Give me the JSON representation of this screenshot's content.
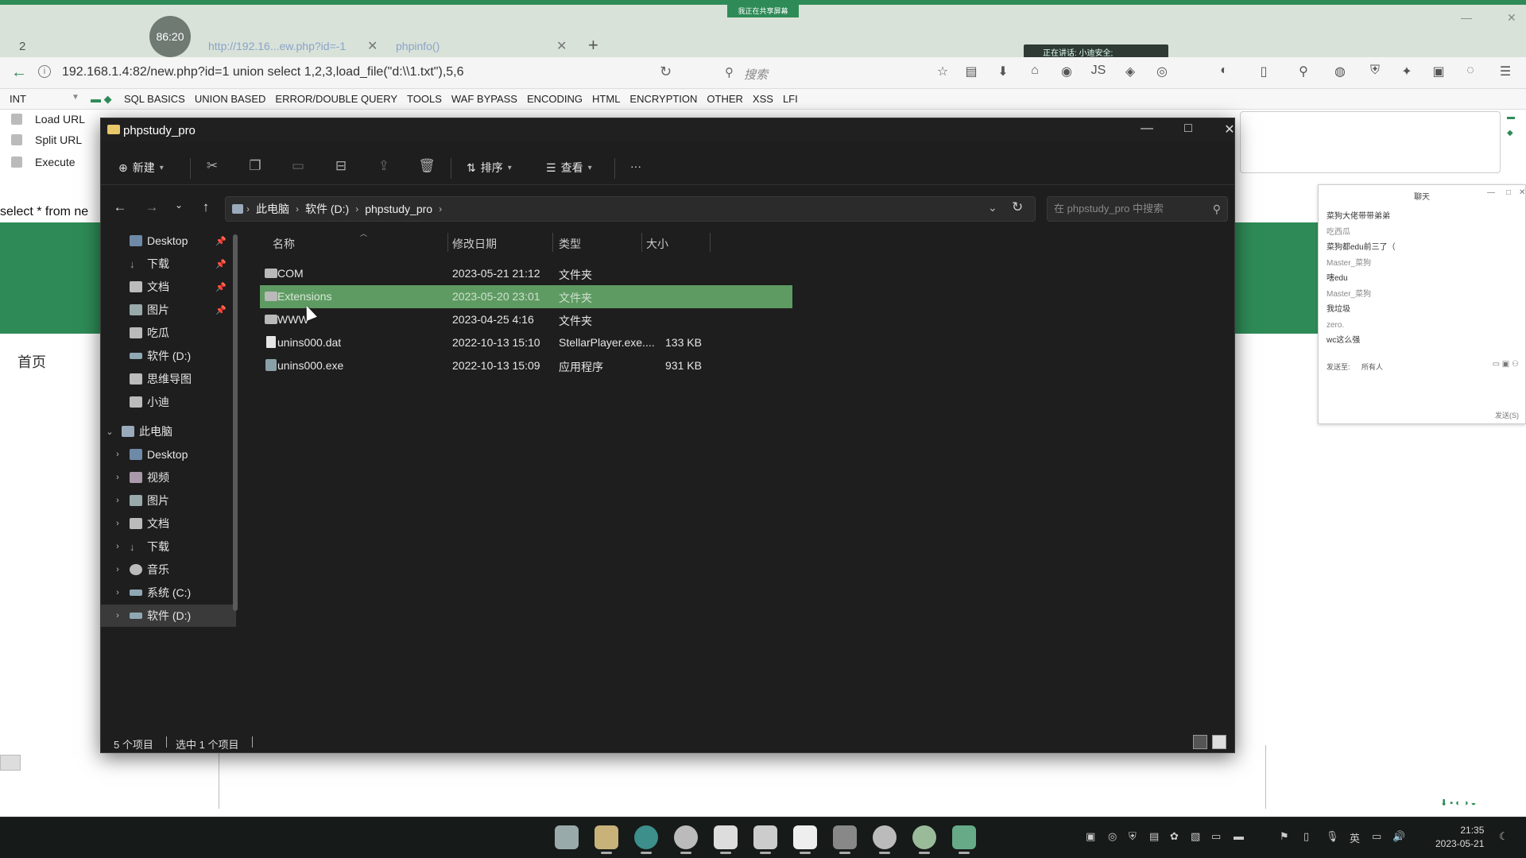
{
  "browser": {
    "tab_number": "2",
    "timer": "86:20",
    "tabs": [
      {
        "label": "http://192.16...ew.php?id=-1"
      },
      {
        "label": "phpinfo()"
      }
    ],
    "share_banner": "我正在共享屏幕",
    "speaking_label": "正在讲话: 小迪安全;",
    "url": "192.168.1.4:82/new.php?id=1 union select 1,2,3,load_file(\"d:\\\\1.txt\"),5,6",
    "search_placeholder": "搜索"
  },
  "hackbar": {
    "type_select": "INT",
    "menus": [
      "SQL BASICS",
      "UNION BASED",
      "ERROR/DOUBLE QUERY",
      "TOOLS",
      "WAF BYPASS",
      "ENCODING",
      "HTML",
      "ENCRYPTION",
      "OTHER",
      "XSS",
      "LFI"
    ],
    "actions": [
      "Load URL",
      "Split URL",
      "Execute"
    ]
  },
  "page": {
    "sql_text": "select * from ne",
    "home_link": "首页"
  },
  "chat": {
    "title": "聊天",
    "messages": [
      {
        "text": "菜狗大佬带带弟弟",
        "sender": false
      },
      {
        "text": "吃西瓜",
        "sender": true
      },
      {
        "text": "菜狗都edu前三了（",
        "sender": false
      },
      {
        "text": "Master_菜狗",
        "sender": true
      },
      {
        "text": "嗐edu",
        "sender": false
      },
      {
        "text": "Master_菜狗",
        "sender": true
      },
      {
        "text": "我垃圾",
        "sender": false
      },
      {
        "text": "zero.",
        "sender": true
      },
      {
        "text": "wc这么强",
        "sender": false
      }
    ],
    "send_to_label": "发送至:",
    "send_to_value": "所有人",
    "send_button": "发送(S)"
  },
  "explorer": {
    "title": "phpstudy_pro",
    "toolbar": {
      "new_label": "新建",
      "sort_label": "排序",
      "view_label": "查看",
      "more_label": "···"
    },
    "breadcrumb": [
      "此电脑",
      "软件 (D:)",
      "phpstudy_pro"
    ],
    "search_placeholder": "在 phpstudy_pro 中搜索",
    "nav_quick": [
      {
        "label": "Desktop",
        "pinned": true
      },
      {
        "label": "下载",
        "pinned": true
      },
      {
        "label": "文档",
        "pinned": true
      },
      {
        "label": "图片",
        "pinned": true
      },
      {
        "label": "吃瓜",
        "pinned": false
      },
      {
        "label": "软件 (D:)",
        "pinned": false
      },
      {
        "label": "思维导图",
        "pinned": false
      },
      {
        "label": "小迪",
        "pinned": false
      }
    ],
    "nav_pc": {
      "label": "此电脑",
      "children": [
        "Desktop",
        "视频",
        "图片",
        "文档",
        "下载",
        "音乐",
        "系统 (C:)",
        "软件 (D:)"
      ]
    },
    "columns": {
      "name": "名称",
      "date": "修改日期",
      "type": "类型",
      "size": "大小"
    },
    "files": [
      {
        "name": "COM",
        "date": "2023-05-21 21:12",
        "type": "文件夹",
        "size": "",
        "kind": "folder",
        "selected": false
      },
      {
        "name": "Extensions",
        "date": "2023-05-20 23:01",
        "type": "文件夹",
        "size": "",
        "kind": "folder",
        "selected": true
      },
      {
        "name": "WWW",
        "date": "2023-04-25 4:16",
        "type": "文件夹",
        "size": "",
        "kind": "folder",
        "selected": false
      },
      {
        "name": "unins000.dat",
        "date": "2022-10-13 15:10",
        "type": "StellarPlayer.exe....",
        "size": "133 KB",
        "kind": "file",
        "selected": false
      },
      {
        "name": "unins000.exe",
        "date": "2022-10-13 15:09",
        "type": "应用程序",
        "size": "931 KB",
        "kind": "exe",
        "selected": false
      }
    ],
    "status": {
      "count": "5 个项目",
      "selected": "选中 1 个项目"
    }
  },
  "taskbar": {
    "ime": "英",
    "time": "21:35",
    "date": "2023-05-21"
  }
}
